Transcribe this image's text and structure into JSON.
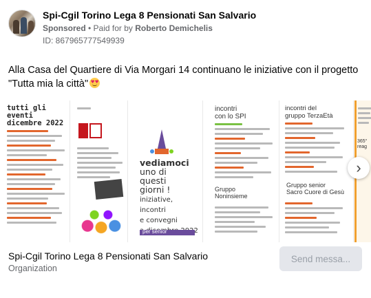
{
  "post": {
    "page_name": "Spi-Cgil Torino Lega 8 Pensionati San Salvario",
    "sponsored": "Sponsored",
    "paid_prefix": " • Paid for by ",
    "paid_by": "Roberto Demichelis",
    "ad_id": "ID: 867965777549939",
    "body_text": "Alla Casa del Quartiere di Via Morgari 14 continuano le iniziative con il progetto \"Tutta mia la città\"",
    "emoji": "smiling-face-with-heart-eyes"
  },
  "carousel": {
    "card1": {
      "title_lines": [
        "tutti gli eventi",
        "dicembre 2022"
      ]
    },
    "card3": {
      "lines": [
        "vediamoci",
        "uno di",
        "questi",
        "giorni !"
      ],
      "sub_lines": [
        "iniziative,",
        "incontri",
        "e convegni",
        "a dicembre 2022"
      ],
      "tag": "per senior"
    },
    "card4": {
      "title_lines": [
        "incontri",
        "con lo SPI"
      ],
      "group_lines": [
        "Gruppo",
        "Noninsieme"
      ]
    },
    "card5": {
      "title_lines": [
        "incontri del",
        "gruppo TerzaEtà"
      ],
      "group_lines": [
        "Gruppo senior",
        "Sacro Cuore di Gesù"
      ]
    },
    "card6": {
      "label_lines": [
        "365°",
        "reag"
      ]
    },
    "next_glyph": "›"
  },
  "footer": {
    "org_name": "Spi-Cgil Torino Lega 8 Pensionati San Salvario",
    "org_type": "Organization",
    "send_label": "Send messa..."
  }
}
